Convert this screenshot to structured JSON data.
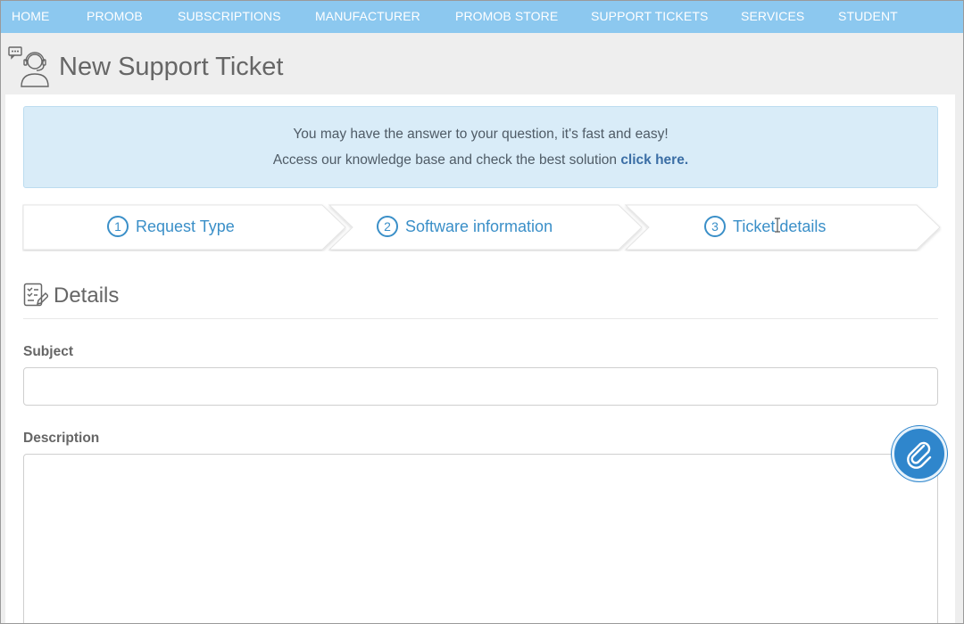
{
  "nav": {
    "items": [
      {
        "label": "HOME"
      },
      {
        "label": "PROMOB"
      },
      {
        "label": "SUBSCRIPTIONS"
      },
      {
        "label": "MANUFACTURER"
      },
      {
        "label": "PROMOB STORE"
      },
      {
        "label": "SUPPORT TICKETS"
      },
      {
        "label": "SERVICES"
      },
      {
        "label": "STUDENT"
      }
    ]
  },
  "header": {
    "title": "New Support Ticket",
    "icon": "support-agent-icon"
  },
  "info": {
    "line1": "You may have the answer to your question, it's fast and easy!",
    "line2_prefix": "Access our knowledge base and check the best solution",
    "link_text": "click here."
  },
  "steps": [
    {
      "number": "1",
      "label": "Request Type"
    },
    {
      "number": "2",
      "label": "Software information"
    },
    {
      "number": "3",
      "label": "Ticket details"
    }
  ],
  "details": {
    "title": "Details",
    "icon": "checklist-edit-icon"
  },
  "form": {
    "subject_label": "Subject",
    "subject_value": "",
    "description_label": "Description",
    "description_value": ""
  },
  "attach": {
    "icon": "paperclip-icon"
  },
  "colors": {
    "nav_bg": "#8cc8ef",
    "accent": "#3a8fc8",
    "info_bg": "#d9ecf8",
    "attach_bg": "#2f86cc"
  }
}
